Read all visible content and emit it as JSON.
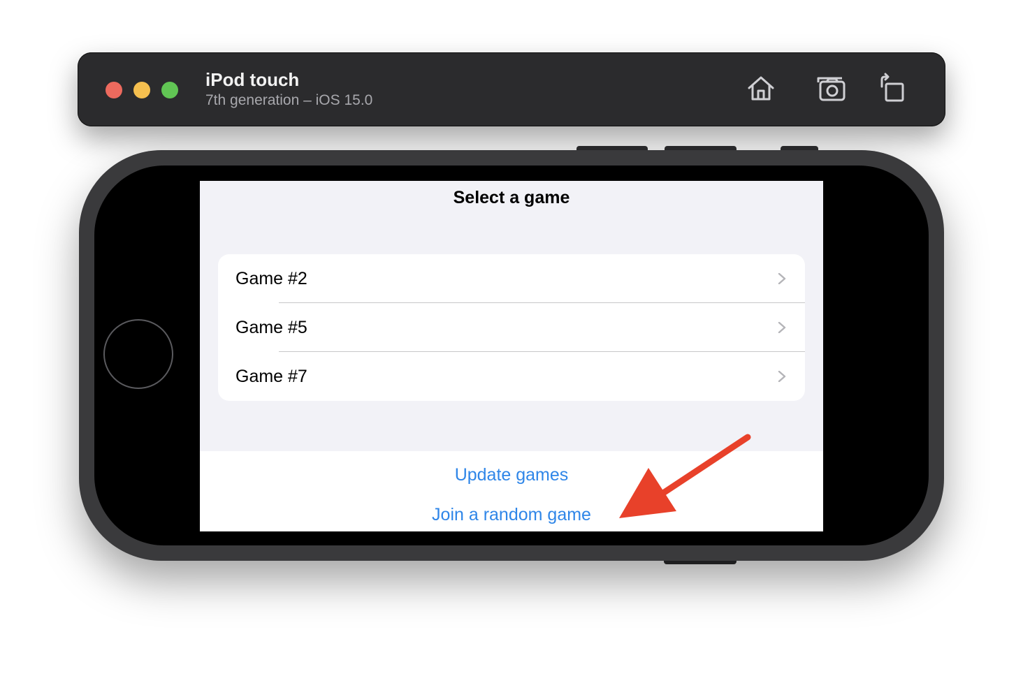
{
  "simulator": {
    "device_name": "iPod touch",
    "device_subtitle": "7th generation – iOS 15.0",
    "toolbar_icons": [
      "home-icon",
      "screenshot-icon",
      "rotate-icon"
    ]
  },
  "screen": {
    "title": "Select a game",
    "games": [
      {
        "label": "Game #2"
      },
      {
        "label": "Game #5"
      },
      {
        "label": "Game #7"
      }
    ],
    "actions": {
      "update_label": "Update games",
      "join_label": "Join a random game"
    }
  },
  "colors": {
    "accent": "#2f86e8",
    "annotation_arrow": "#e8412a",
    "traffic_red": "#ed6a5e",
    "traffic_yellow": "#f5bf4f",
    "traffic_green": "#61c554"
  }
}
